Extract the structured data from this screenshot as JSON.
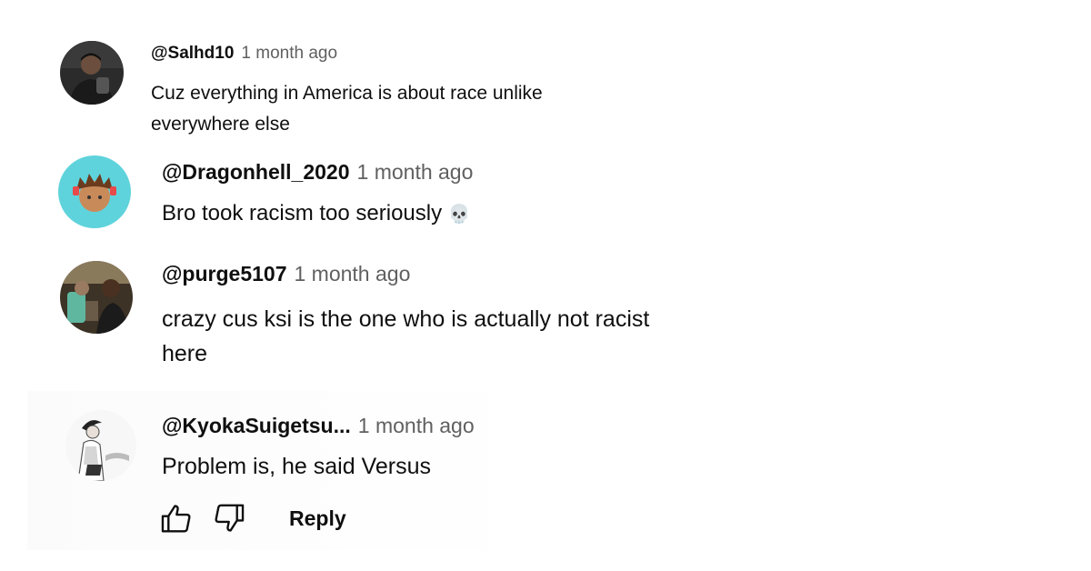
{
  "comments": [
    {
      "handle": "@Salhd10",
      "time": "1 month ago",
      "text_line1": "Cuz everything in America is about race unlike",
      "text_line2": "everywhere else"
    },
    {
      "handle": "@Dragonhell_2020",
      "time": "1 month ago",
      "text": "Bro took racism too seriously",
      "emoji": "💀"
    },
    {
      "handle": "@purge5107",
      "time": "1 month ago",
      "text_line1": "crazy cus ksi is the one who is actually not racist",
      "text_line2": "here"
    },
    {
      "handle": "@KyokaSuigetsu...",
      "time": "1 month ago",
      "text": "Problem is, he said Versus"
    }
  ],
  "actions": {
    "like_icon": "thumbs-up-icon",
    "dislike_icon": "thumbs-down-icon",
    "reply_label": "Reply"
  },
  "colors": {
    "text": "#0f0f0f",
    "secondary": "#606060",
    "avatar2_bg": "#5fd3dc"
  }
}
